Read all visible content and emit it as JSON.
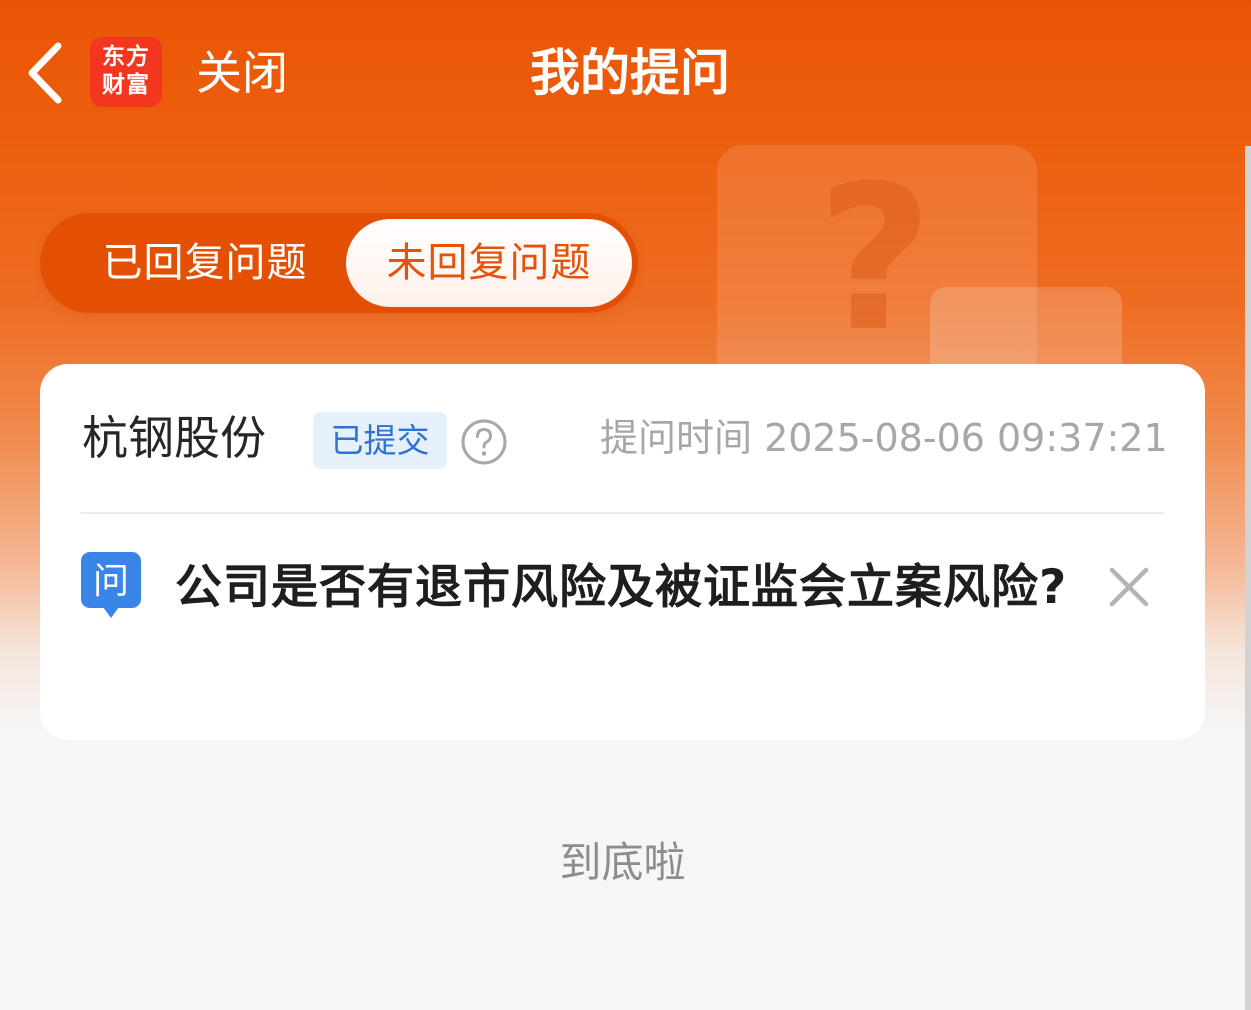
{
  "header": {
    "logo_line1": "东方",
    "logo_line2": "财富",
    "close_label": "关闭",
    "title": "我的提问"
  },
  "tabs": [
    {
      "label": "已回复问题",
      "active": false
    },
    {
      "label": "未回复问题",
      "active": true
    }
  ],
  "decoration": {
    "question_mark": "?"
  },
  "question_card": {
    "stock_name": "杭钢股份",
    "status": "已提交",
    "time_label": "提问时间 2025-08-06 09:37:21",
    "q_badge": "问",
    "question_text": "公司是否有退市风险及被证监会立案风险?"
  },
  "footer": {
    "end_text": "到底啦"
  },
  "colors": {
    "brand_orange": "#ea5505",
    "tab_active_text": "#e45309",
    "badge_blue": "#2f73d2",
    "badge_bg": "#e6f0fb",
    "q_icon_blue": "#3a86e8"
  }
}
